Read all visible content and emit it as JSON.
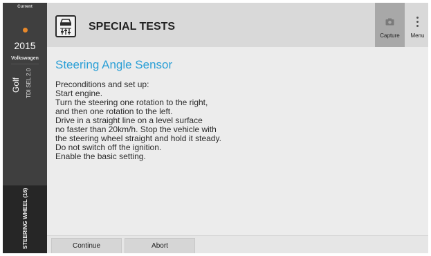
{
  "sidebar": {
    "current_label": "Current",
    "year": "2015",
    "make": "Volkswagen",
    "model": "Golf",
    "trim": "TDI SEL 2.0",
    "module": "STEERING WHEEL (16)",
    "status_dot_color": "#e8882a"
  },
  "header": {
    "title": "SPECIAL TESTS",
    "capture_label": "Capture",
    "menu_label": "Menu"
  },
  "content": {
    "title": "Steering Angle Sensor",
    "lines": [
      "Preconditions and set up:",
      "Start engine.",
      "Turn the steering one rotation to the right,",
      "and then one rotation to the left.",
      "Drive in a straight line on a level surface",
      "no faster than 20km/h. Stop the vehicle with",
      "the steering wheel straight and hold it steady.",
      "Do not switch off the ignition.",
      "Enable the basic setting."
    ]
  },
  "footer": {
    "continue_label": "Continue",
    "abort_label": "Abort"
  },
  "colors": {
    "accent": "#2a9fd6",
    "sidebar": "#3f3f3f"
  }
}
